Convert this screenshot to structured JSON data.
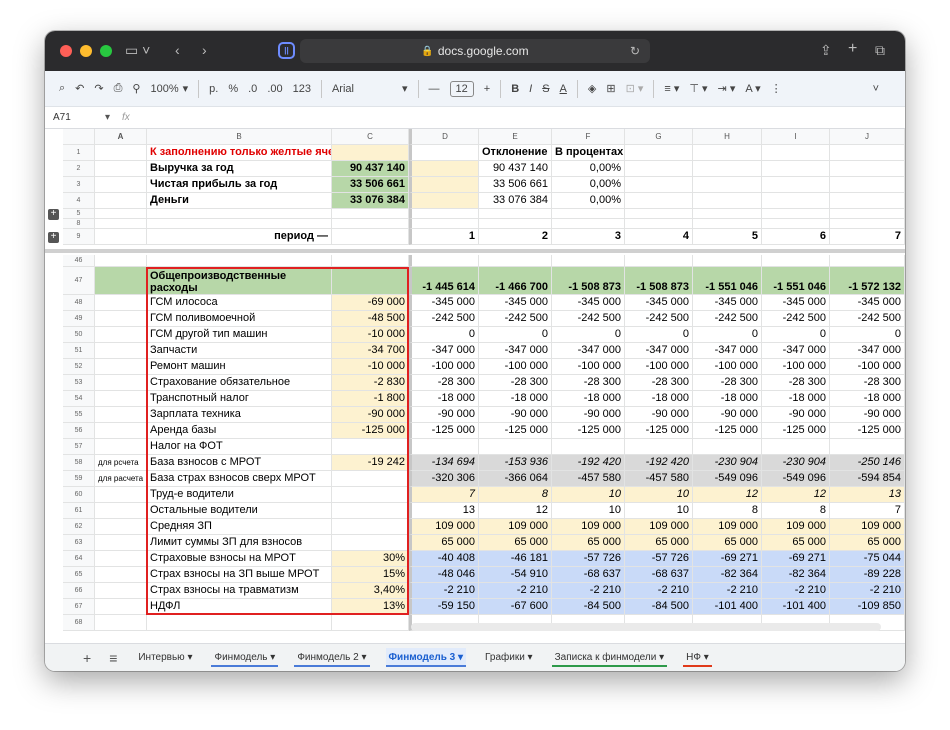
{
  "browser": {
    "url": "docs.google.com"
  },
  "toolbar": {
    "zoom": "100%",
    "format_p": "р.",
    "format_pct": "%",
    "dec_minus": ".0",
    "dec_plus": ".00",
    "fmt_123": "123",
    "font": "Arial",
    "font_size": "12"
  },
  "formula_bar": {
    "cell_ref": "A71",
    "fx": "fx"
  },
  "col_headers": [
    "A",
    "B",
    "C",
    "D",
    "E",
    "F",
    "G",
    "H",
    "I",
    "J"
  ],
  "top_rows": [
    {
      "n": "1",
      "A": "",
      "B": "К заполнению только желтые ячейки!",
      "C": "",
      "D": "",
      "E": "Отклонение",
      "F": "В процентах",
      "G": "",
      "H": "",
      "I": "",
      "J": ""
    },
    {
      "n": "2",
      "A": "",
      "B": "Выручка за год",
      "C": "90 437 140",
      "D": "",
      "E": "90 437 140",
      "F": "0,00%",
      "G": "",
      "H": "",
      "I": "",
      "J": ""
    },
    {
      "n": "3",
      "A": "",
      "B": "Чистая прибыль за год",
      "C": "33 506 661",
      "D": "",
      "E": "33 506 661",
      "F": "0,00%",
      "G": "",
      "H": "",
      "I": "",
      "J": ""
    },
    {
      "n": "4",
      "A": "",
      "B": "Деньги",
      "C": "33 076 384",
      "D": "",
      "E": "33 076 384",
      "F": "0,00%",
      "G": "",
      "H": "",
      "I": "",
      "J": ""
    },
    {
      "n": "5",
      "A": "",
      "B": "",
      "C": "",
      "D": "",
      "E": "",
      "F": "",
      "G": "",
      "H": "",
      "I": "",
      "J": ""
    },
    {
      "n": "8",
      "A": "",
      "B": "",
      "C": "",
      "D": "",
      "E": "",
      "F": "",
      "G": "",
      "H": "",
      "I": "",
      "J": ""
    },
    {
      "n": "9",
      "A": "",
      "B": "период —",
      "C": "",
      "D": "1",
      "E": "2",
      "F": "3",
      "G": "4",
      "H": "5",
      "I": "6",
      "J": "7"
    }
  ],
  "rows": [
    {
      "n": "46",
      "A": "",
      "B": "",
      "C": "",
      "D": "",
      "E": "",
      "F": "",
      "G": "",
      "H": "",
      "I": "",
      "J": ""
    },
    {
      "n": "47",
      "A": "",
      "B": "Общепроизводственные расходы",
      "C": "",
      "D": "-1 445 614",
      "E": "-1 466 700",
      "F": "-1 508 873",
      "G": "-1 508 873",
      "H": "-1 551 046",
      "I": "-1 551 046",
      "J": "-1 572 132"
    },
    {
      "n": "48",
      "A": "",
      "B": "ГСМ илососа",
      "C": "-69 000",
      "D": "-345 000",
      "E": "-345 000",
      "F": "-345 000",
      "G": "-345 000",
      "H": "-345 000",
      "I": "-345 000",
      "J": "-345 000"
    },
    {
      "n": "49",
      "A": "",
      "B": "ГСМ поливомоечной",
      "C": "-48 500",
      "D": "-242 500",
      "E": "-242 500",
      "F": "-242 500",
      "G": "-242 500",
      "H": "-242 500",
      "I": "-242 500",
      "J": "-242 500"
    },
    {
      "n": "50",
      "A": "",
      "B": "ГСМ другой тип машин",
      "C": "-10 000",
      "D": "0",
      "E": "0",
      "F": "0",
      "G": "0",
      "H": "0",
      "I": "0",
      "J": "0"
    },
    {
      "n": "51",
      "A": "",
      "B": "Запчасти",
      "C": "-34 700",
      "D": "-347 000",
      "E": "-347 000",
      "F": "-347 000",
      "G": "-347 000",
      "H": "-347 000",
      "I": "-347 000",
      "J": "-347 000"
    },
    {
      "n": "52",
      "A": "",
      "B": "Ремонт машин",
      "C": "-10 000",
      "D": "-100 000",
      "E": "-100 000",
      "F": "-100 000",
      "G": "-100 000",
      "H": "-100 000",
      "I": "-100 000",
      "J": "-100 000"
    },
    {
      "n": "53",
      "A": "",
      "B": "Страхование обязательное",
      "C": "-2 830",
      "D": "-28 300",
      "E": "-28 300",
      "F": "-28 300",
      "G": "-28 300",
      "H": "-28 300",
      "I": "-28 300",
      "J": "-28 300"
    },
    {
      "n": "54",
      "A": "",
      "B": "Транспотный налог",
      "C": "-1 800",
      "D": "-18 000",
      "E": "-18 000",
      "F": "-18 000",
      "G": "-18 000",
      "H": "-18 000",
      "I": "-18 000",
      "J": "-18 000"
    },
    {
      "n": "55",
      "A": "",
      "B": "Зарплата техника",
      "C": "-90 000",
      "D": "-90 000",
      "E": "-90 000",
      "F": "-90 000",
      "G": "-90 000",
      "H": "-90 000",
      "I": "-90 000",
      "J": "-90 000"
    },
    {
      "n": "56",
      "A": "",
      "B": "Аренда базы",
      "C": "-125 000",
      "D": "-125 000",
      "E": "-125 000",
      "F": "-125 000",
      "G": "-125 000",
      "H": "-125 000",
      "I": "-125 000",
      "J": "-125 000"
    },
    {
      "n": "57",
      "A": "",
      "B": "Налог на ФОТ",
      "C": "",
      "D": "",
      "E": "",
      "F": "",
      "G": "",
      "H": "",
      "I": "",
      "J": ""
    },
    {
      "n": "58",
      "A": "для рсчета",
      "B": "База взносов с МРОТ",
      "C": "-19 242",
      "D": "-134 694",
      "E": "-153 936",
      "F": "-192 420",
      "G": "-192 420",
      "H": "-230 904",
      "I": "-230 904",
      "J": "-250 146"
    },
    {
      "n": "59",
      "A": "для расчета",
      "B": "База страх взносов сверх МРОТ",
      "C": "",
      "D": "-320 306",
      "E": "-366 064",
      "F": "-457 580",
      "G": "-457 580",
      "H": "-549 096",
      "I": "-549 096",
      "J": "-594 854"
    },
    {
      "n": "60",
      "A": "",
      "B": "Труд-е водители",
      "C": "",
      "D": "7",
      "E": "8",
      "F": "10",
      "G": "10",
      "H": "12",
      "I": "12",
      "J": "13"
    },
    {
      "n": "61",
      "A": "",
      "B": "Остальные водители",
      "C": "",
      "D": "13",
      "E": "12",
      "F": "10",
      "G": "10",
      "H": "8",
      "I": "8",
      "J": "7"
    },
    {
      "n": "62",
      "A": "",
      "B": "Средняя ЗП",
      "C": "",
      "D": "109 000",
      "E": "109 000",
      "F": "109 000",
      "G": "109 000",
      "H": "109 000",
      "I": "109 000",
      "J": "109 000"
    },
    {
      "n": "63",
      "A": "",
      "B": "Лимит суммы ЗП для взносов",
      "C": "",
      "D": "65 000",
      "E": "65 000",
      "F": "65 000",
      "G": "65 000",
      "H": "65 000",
      "I": "65 000",
      "J": "65 000"
    },
    {
      "n": "64",
      "A": "",
      "B": "Страховые взносы на МРОТ",
      "C": "30%",
      "D": "-40 408",
      "E": "-46 181",
      "F": "-57 726",
      "G": "-57 726",
      "H": "-69 271",
      "I": "-69 271",
      "J": "-75 044"
    },
    {
      "n": "65",
      "A": "",
      "B": "Страх взносы на ЗП выше МРОТ",
      "C": "15%",
      "D": "-48 046",
      "E": "-54 910",
      "F": "-68 637",
      "G": "-68 637",
      "H": "-82 364",
      "I": "-82 364",
      "J": "-89 228"
    },
    {
      "n": "66",
      "A": "",
      "B": "Страх взносы на травматизм",
      "C": "3,40%",
      "D": "-2 210",
      "E": "-2 210",
      "F": "-2 210",
      "G": "-2 210",
      "H": "-2 210",
      "I": "-2 210",
      "J": "-2 210"
    },
    {
      "n": "67",
      "A": "",
      "B": "НДФЛ",
      "C": "13%",
      "D": "-59 150",
      "E": "-67 600",
      "F": "-84 500",
      "G": "-84 500",
      "H": "-101 400",
      "I": "-101 400",
      "J": "-109 850"
    },
    {
      "n": "68",
      "A": "",
      "B": "",
      "C": "",
      "D": "",
      "E": "",
      "F": "",
      "G": "",
      "H": "",
      "I": "",
      "J": ""
    }
  ],
  "sheet_tabs": [
    {
      "label": "Интервью ▾",
      "color": ""
    },
    {
      "label": "Финмодель ▾",
      "color": "#4a7bd8"
    },
    {
      "label": "Финмодель 2 ▾",
      "color": "#4a7bd8"
    },
    {
      "label": "Финмодель 3 ▾",
      "color": "#4a7bd8"
    },
    {
      "label": "Графики ▾",
      "color": ""
    },
    {
      "label": "Записка к финмодели ▾",
      "color": "#2e9a4a"
    },
    {
      "label": "НФ ▾",
      "color": "#e03a1a"
    }
  ],
  "active_tab_index": 3,
  "colors": {
    "yellow_input": "#fdf2d0",
    "green_header": "#b7d7a8",
    "gray_italic": "#d9d9d9",
    "blue_calc": "#c9daf8",
    "highlight_box": "#e02020"
  }
}
